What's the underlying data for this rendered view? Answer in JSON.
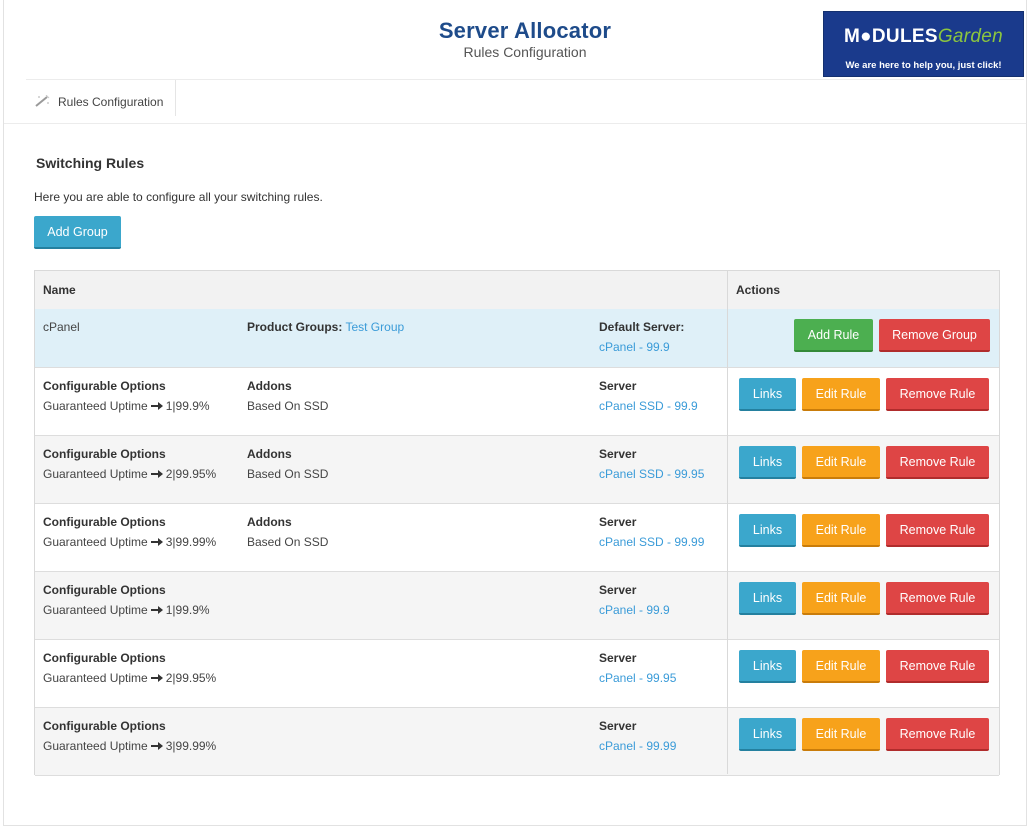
{
  "header": {
    "title": "Server Allocator",
    "subtitle": "Rules Configuration",
    "logo": {
      "modules": "M●DULES",
      "garden": "Garden",
      "tagline": "We are here to help you, just click!"
    }
  },
  "nav": {
    "item_label": "Rules Configuration"
  },
  "section": {
    "title": "Switching Rules",
    "description": "Here you are able to configure all your switching rules.",
    "add_group_label": "Add Group"
  },
  "table": {
    "col_name": "Name",
    "col_actions": "Actions",
    "group": {
      "name": "cPanel",
      "product_groups_label": "Product Groups:",
      "product_groups_value": "Test Group",
      "default_server_label": "Default Server:",
      "default_server_value": "cPanel - 99.9",
      "add_rule_label": "Add Rule",
      "remove_group_label": "Remove Group"
    },
    "rule_buttons": {
      "links": "Links",
      "edit": "Edit Rule",
      "remove": "Remove Rule"
    },
    "rules": [
      {
        "opt_label": "Configurable Options",
        "opt_name": "Guaranteed Uptime",
        "opt_value": "1|99.9%",
        "addon_label": "Addons",
        "addon_value": "Based On SSD",
        "server_label": "Server",
        "server_value": "cPanel SSD - 99.9"
      },
      {
        "opt_label": "Configurable Options",
        "opt_name": "Guaranteed Uptime",
        "opt_value": "2|99.95%",
        "addon_label": "Addons",
        "addon_value": "Based On SSD",
        "server_label": "Server",
        "server_value": "cPanel SSD - 99.95"
      },
      {
        "opt_label": "Configurable Options",
        "opt_name": "Guaranteed Uptime",
        "opt_value": "3|99.99%",
        "addon_label": "Addons",
        "addon_value": "Based On SSD",
        "server_label": "Server",
        "server_value": "cPanel SSD - 99.99"
      },
      {
        "opt_label": "Configurable Options",
        "opt_name": "Guaranteed Uptime",
        "opt_value": "1|99.9%",
        "addon_label": "",
        "addon_value": "",
        "server_label": "Server",
        "server_value": "cPanel - 99.9"
      },
      {
        "opt_label": "Configurable Options",
        "opt_name": "Guaranteed Uptime",
        "opt_value": "2|99.95%",
        "addon_label": "",
        "addon_value": "",
        "server_label": "Server",
        "server_value": "cPanel - 99.95"
      },
      {
        "opt_label": "Configurable Options",
        "opt_name": "Guaranteed Uptime",
        "opt_value": "3|99.99%",
        "addon_label": "",
        "addon_value": "",
        "server_label": "Server",
        "server_value": "cPanel - 99.99"
      }
    ]
  },
  "colors": {
    "title_blue": "#1e4b8a",
    "link_blue": "#3a9bd8",
    "info": "#3ba7cc",
    "success": "#4caf50",
    "warning": "#f7a21b",
    "danger": "#de4545",
    "group_row": "#dff0f8"
  },
  "icons": {
    "nav": "magic-wand-icon",
    "arrow": "arrow-right-icon"
  }
}
